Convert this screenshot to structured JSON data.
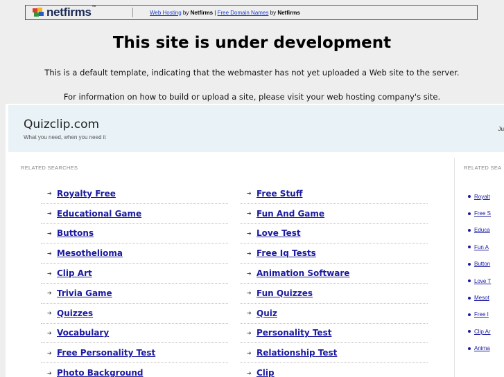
{
  "netfirms": {
    "logo_text": "netfirms",
    "logo_tm": "™",
    "link1": "Web Hosting",
    "by1": "by",
    "brand1": "Netfirms",
    "divider": "|",
    "link2": "Free Domain Names",
    "by2": "by",
    "brand2": "Netfirms"
  },
  "notice": {
    "title": "This site is under development",
    "line1": "This is a default template, indicating that the webmaster has not yet uploaded a Web site to the server.",
    "line2": "For information on how to build or upload a site, please visit your web hosting company's site."
  },
  "parked": {
    "site_name": "Quizclip.com",
    "tagline": "What you need, when you need it",
    "header_right": "Ju",
    "related_label": "RELATED SEARCHES",
    "side_label": "RELATED SEA",
    "column1": [
      "Royalty Free",
      "Educational Game",
      "Buttons",
      "Mesothelioma",
      "Clip Art",
      "Trivia Game",
      "Quizzes",
      "Vocabulary",
      "Free Personality Test",
      "Photo Background"
    ],
    "column2": [
      "Free Stuff",
      "Fun And Game",
      "Love Test",
      "Free Iq Tests",
      "Animation Software",
      "Fun Quizzes",
      "Quiz",
      "Personality Test",
      "Relationship Test",
      "Clip"
    ],
    "side": [
      "Royalt",
      "Free S",
      "Educa",
      "Fun A",
      "Button",
      "Love T",
      "Mesot",
      "Free I",
      "Clip Ar",
      "Anima"
    ]
  }
}
